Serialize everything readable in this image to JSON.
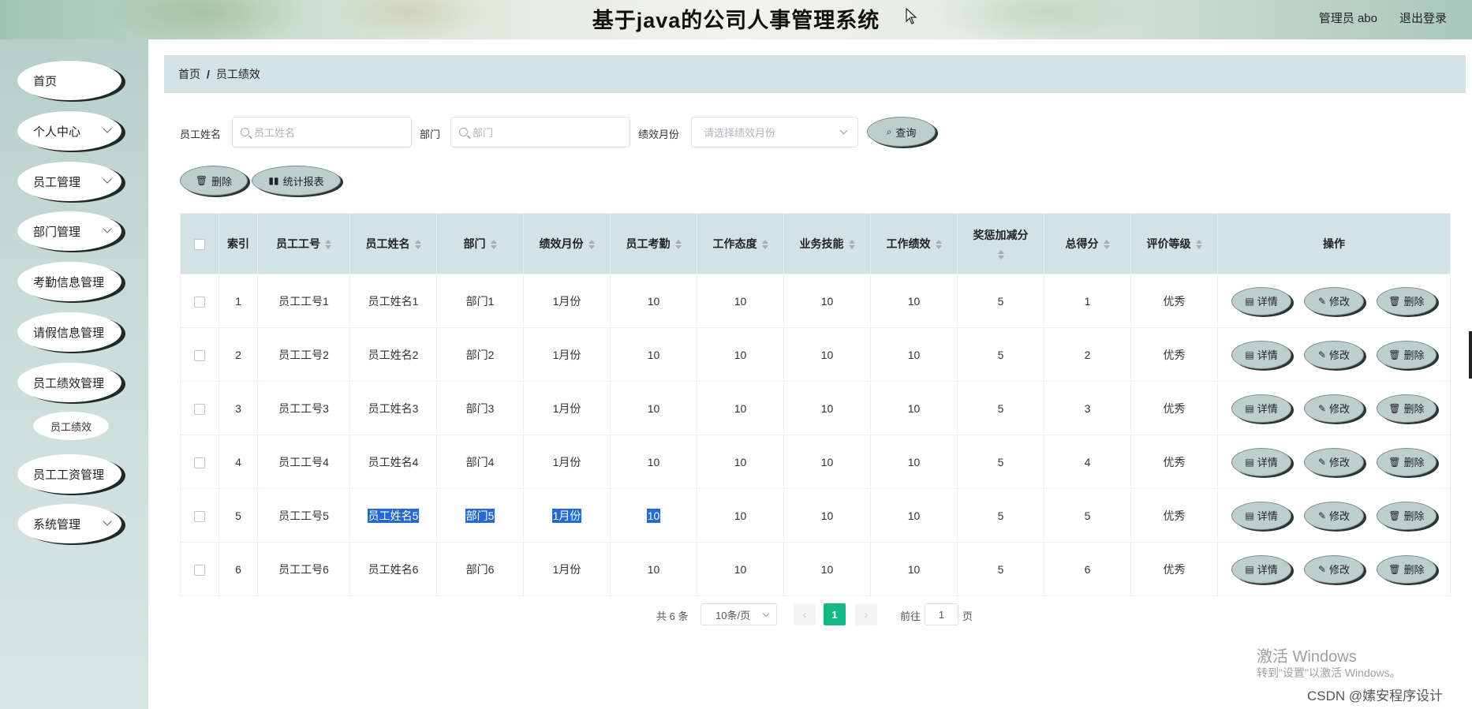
{
  "app": {
    "title": "基于java的公司人事管理系统"
  },
  "header": {
    "user": "管理员 abo",
    "logout": "退出登录"
  },
  "sidebar": {
    "items": [
      {
        "label": "首页",
        "has_arrow": false
      },
      {
        "label": "个人中心",
        "has_arrow": true
      },
      {
        "label": "员工管理",
        "has_arrow": true
      },
      {
        "label": "部门管理",
        "has_arrow": true
      },
      {
        "label": "考勤信息管理",
        "has_arrow": false
      },
      {
        "label": "请假信息管理",
        "has_arrow": false
      },
      {
        "label": "员工绩效管理",
        "has_arrow": false
      },
      {
        "label": "员工工资管理",
        "has_arrow": false
      },
      {
        "label": "系统管理",
        "has_arrow": true
      }
    ],
    "submenu": {
      "label": "员工绩效"
    }
  },
  "breadcrumb": {
    "home": "首页",
    "sep": "/",
    "current": "员工绩效"
  },
  "search": {
    "name_label": "员工姓名",
    "name_placeholder": "员工姓名",
    "dept_label": "部门",
    "dept_placeholder": "部门",
    "month_label": "绩效月份",
    "month_placeholder": "请选择绩效月份",
    "query_button": "查询"
  },
  "actions": {
    "delete": "删除",
    "report": "统计报表"
  },
  "table": {
    "columns": [
      "索引",
      "员工工号",
      "员工姓名",
      "部门",
      "绩效月份",
      "员工考勤",
      "工作态度",
      "业务技能",
      "工作绩效",
      "奖惩加减分",
      "总得分",
      "评价等级",
      "操作"
    ],
    "rows": [
      {
        "idx": "1",
        "emp_no": "员工工号1",
        "name": "员工姓名1",
        "dept": "部门1",
        "month": "1月份",
        "attendance": "10",
        "attitude": "10",
        "skill": "10",
        "performance": "10",
        "bonus": "5",
        "total": "1",
        "grade": "优秀"
      },
      {
        "idx": "2",
        "emp_no": "员工工号2",
        "name": "员工姓名2",
        "dept": "部门2",
        "month": "1月份",
        "attendance": "10",
        "attitude": "10",
        "skill": "10",
        "performance": "10",
        "bonus": "5",
        "total": "2",
        "grade": "优秀"
      },
      {
        "idx": "3",
        "emp_no": "员工工号3",
        "name": "员工姓名3",
        "dept": "部门3",
        "month": "1月份",
        "attendance": "10",
        "attitude": "10",
        "skill": "10",
        "performance": "10",
        "bonus": "5",
        "total": "3",
        "grade": "优秀"
      },
      {
        "idx": "4",
        "emp_no": "员工工号4",
        "name": "员工姓名4",
        "dept": "部门4",
        "month": "1月份",
        "attendance": "10",
        "attitude": "10",
        "skill": "10",
        "performance": "10",
        "bonus": "5",
        "total": "4",
        "grade": "优秀"
      },
      {
        "idx": "5",
        "emp_no": "员工工号5",
        "name": "员工姓名5",
        "dept": "部门5",
        "month": "1月份",
        "attendance": "10",
        "attitude": "10",
        "skill": "10",
        "performance": "10",
        "bonus": "5",
        "total": "5",
        "grade": "优秀"
      },
      {
        "idx": "6",
        "emp_no": "员工工号6",
        "name": "员工姓名6",
        "dept": "部门6",
        "month": "1月份",
        "attendance": "10",
        "attitude": "10",
        "skill": "10",
        "performance": "10",
        "bonus": "5",
        "total": "6",
        "grade": "优秀"
      }
    ],
    "row_buttons": {
      "detail": "详情",
      "edit": "修改",
      "delete": "删除"
    }
  },
  "pagination": {
    "total": "共 6 条",
    "page_size": "10条/页",
    "current": "1",
    "goto_prefix": "前往",
    "goto_value": "1",
    "goto_suffix": "页"
  },
  "watermark": {
    "line1": "激活 Windows",
    "line2": "转到\"设置\"以激活 Windows。",
    "credit": "CSDN @嫊安程序设计"
  },
  "colors": {
    "accent": "#13b982",
    "header_bg": "#d3e2e2",
    "button_bg": "#bccfcd",
    "selection": "#2469d6"
  }
}
